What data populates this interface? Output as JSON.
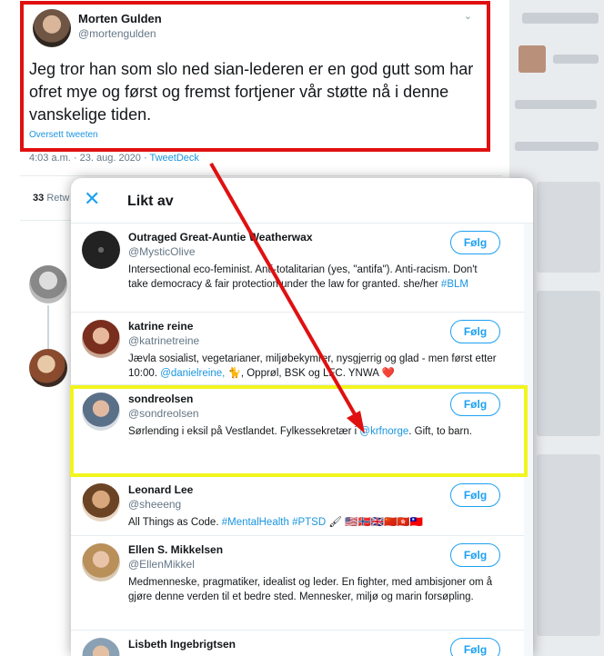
{
  "tweet": {
    "author_name": "Morten Gulden",
    "author_handle": "@mortengulden",
    "caret": "⌄",
    "text": "Jeg tror han som slo ned sian-lederen er en god gutt som har ofret mye og først og fremst fortjener vår støtte nå i denne vanskelige tiden.",
    "translate_label": "Oversett tweeten",
    "timestamp": "4:03 a.m. · 23. aug. 2020 · ",
    "source": "TweetDeck",
    "retweets_count": "33",
    "retweets_label": "Retw"
  },
  "modal": {
    "close_icon": "✕",
    "title": "Likt av",
    "follow_label": "Følg",
    "users": [
      {
        "name": "Outraged Great-Auntie Weatherwax",
        "handle": "@MysticOlive",
        "bio": "Intersectional eco-feminist. Anti-totalitarian (yes, \"antifa\"). Anti-racism. Don't take democracy & fair protection under the law for granted. she/her",
        "bio_link": "#BLM"
      },
      {
        "name": "katrine reine",
        "handle": "@katrinetreine",
        "bio": "Jævla sosialist, vegetarianer, miljøbekymrer, nysgjerrig og glad - men først etter 10:00.",
        "bio_link": "@danielreine,",
        "bio_tail": "🐈, Opprøl, BSK og LFC. YNWA ❤️"
      },
      {
        "name": "sondreolsen",
        "handle": "@sondreolsen",
        "bio": "Sørlending i eksil på Vestlandet. Fylkessekretær i",
        "bio_link": "@krfnorge",
        "bio_tail": ". Gift, to barn."
      },
      {
        "name": "Leonard Lee",
        "handle": "@sheeeng",
        "bio": "All Things as Code.",
        "bio_link": "#MentalHealth #PTSD",
        "bio_tail": "🖌 🇺🇸🇳🇴🇬🇧🇨🇳🇭🇰🇹🇼"
      },
      {
        "name": "Ellen S. Mikkelsen",
        "handle": "@EllenMikkel",
        "bio": "Medmenneske, pragmatiker, idealist og leder. En fighter, med ambisjoner om å gjøre denne verden til et bedre sted. Mennesker, miljø og marin forsøpling."
      },
      {
        "name": "Lisbeth Ingebrigtsen"
      }
    ]
  },
  "colors": {
    "red_box": "#e01010",
    "yellow_box": "#f1f51d",
    "accent": "#1da1f2"
  }
}
